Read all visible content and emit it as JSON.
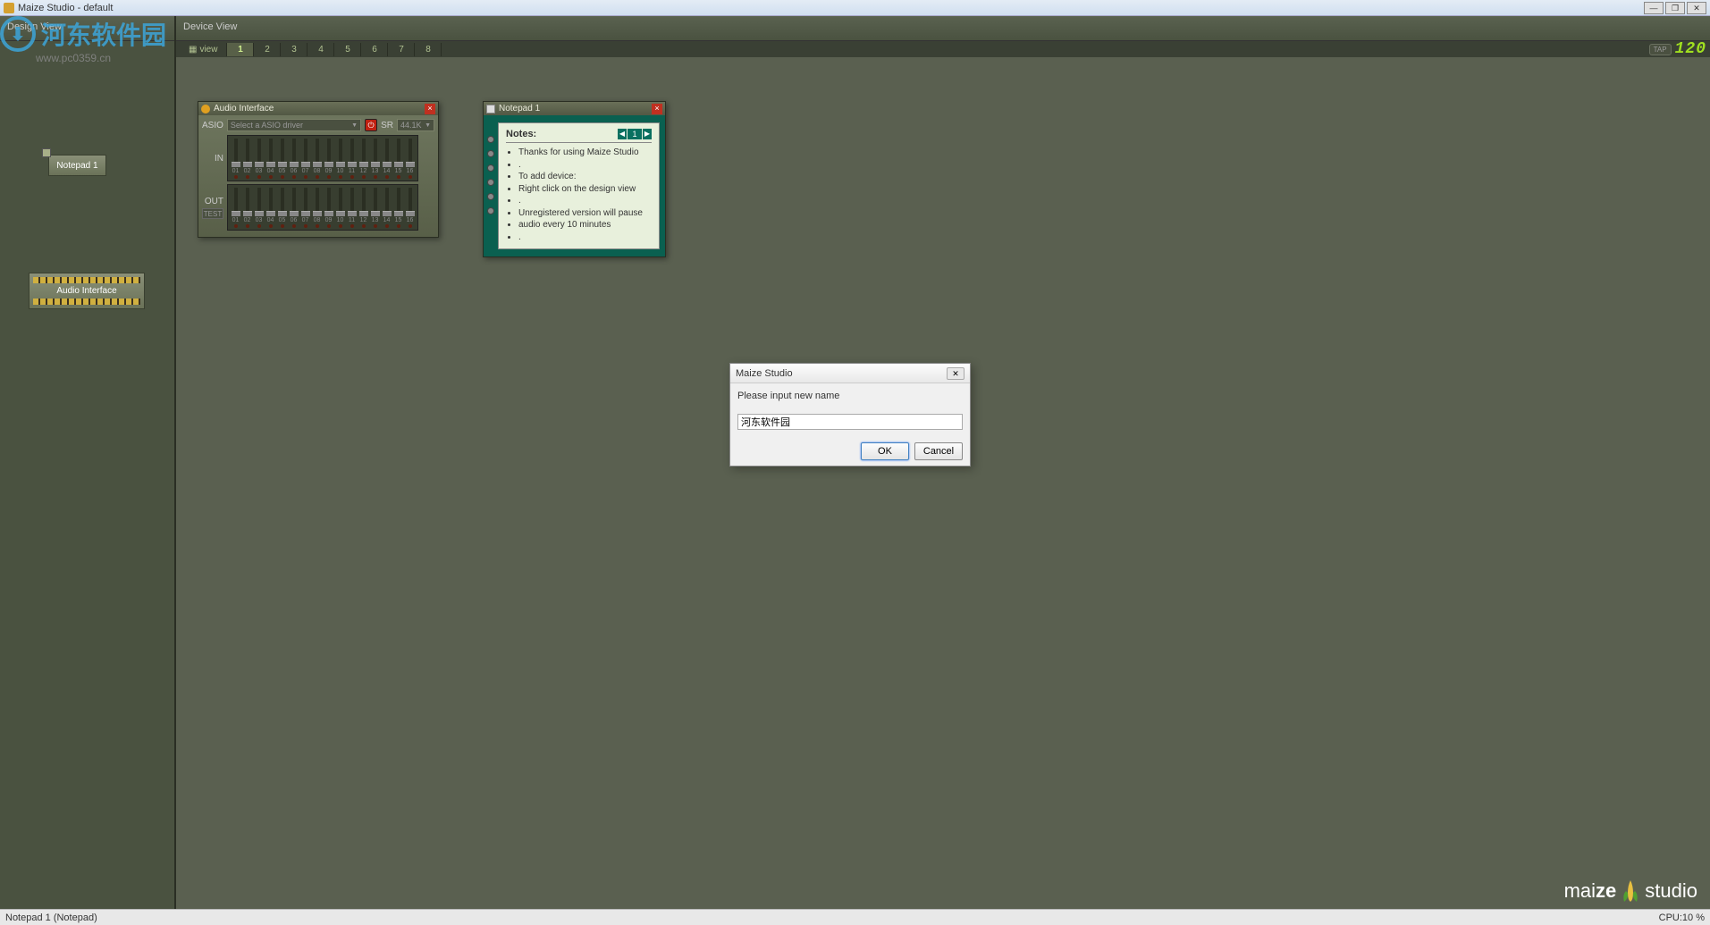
{
  "window": {
    "title": "Maize Studio - default"
  },
  "watermark": {
    "logo_text": "河东软件园",
    "url": "www.pc0359.cn"
  },
  "sidebar": {
    "header": "Design View",
    "nodes": {
      "notepad": "Notepad 1",
      "audio_interface": "Audio Interface"
    }
  },
  "device_view": {
    "header": "Device View",
    "tabs": {
      "view_label": "view",
      "items": [
        "1",
        "2",
        "3",
        "4",
        "5",
        "6",
        "7",
        "8"
      ],
      "active_index": 0
    },
    "tempo": {
      "tap_label": "TAP",
      "bpm": "120"
    }
  },
  "audio_panel": {
    "title": "Audio Interface",
    "asio_label": "ASIO",
    "asio_value": "Select a ASIO driver",
    "sr_label": "SR",
    "sr_value": "44.1K",
    "in_label": "IN",
    "out_label": "OUT",
    "test_label": "TEST",
    "channel_numbers": [
      "01",
      "02",
      "03",
      "04",
      "05",
      "06",
      "07",
      "08",
      "09",
      "10",
      "11",
      "12",
      "13",
      "14",
      "15",
      "16"
    ]
  },
  "notepad_panel": {
    "title": "Notepad 1",
    "header": "Notes:",
    "page": "1",
    "lines": [
      "Thanks for using Maize Studio",
      ".",
      "To add device:",
      "Right click on the design view",
      ".",
      "Unregistered version will pause",
      "audio every 10 minutes",
      "."
    ]
  },
  "dialog": {
    "title": "Maize Studio",
    "label": "Please input new name",
    "input_value": "河东软件园",
    "ok": "OK",
    "cancel": "Cancel"
  },
  "brand": {
    "part1": "mai",
    "part2": "ze",
    "part3": "studio"
  },
  "statusbar": {
    "left": "Notepad 1 (Notepad)",
    "right": "CPU:10 %"
  }
}
